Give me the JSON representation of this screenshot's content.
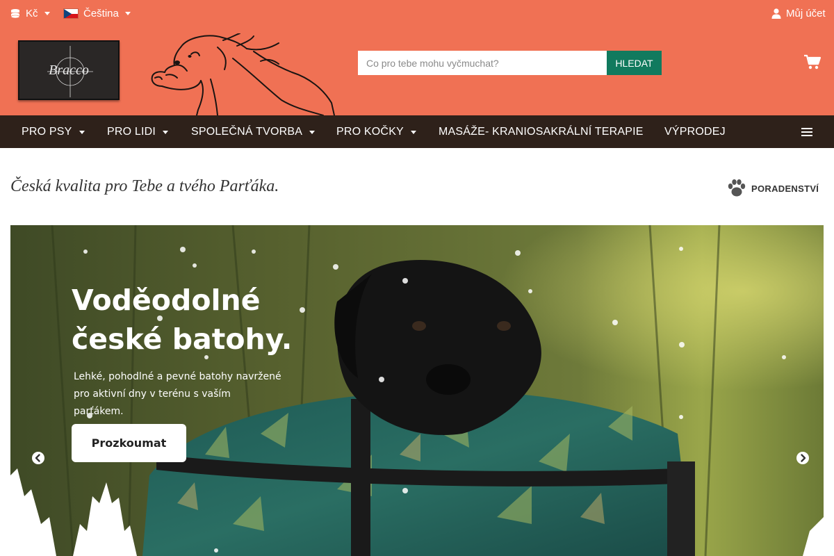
{
  "topbar": {
    "currency": "Kč",
    "language": "Čeština",
    "account": "Můj účet"
  },
  "header": {
    "logo_text": "Bracco",
    "search": {
      "placeholder": "Co pro tebe mohu vyčmuchat?",
      "button": "HLEDAT"
    }
  },
  "nav": {
    "items": [
      {
        "label": "PRO PSY"
      },
      {
        "label": "PRO LIDI"
      },
      {
        "label": "SPOLEČNÁ TVORBA"
      },
      {
        "label": "PRO KOČKY"
      },
      {
        "label": "MASÁŽE- KRANIOSAKRÁLNÍ TERAPIE"
      },
      {
        "label": "VÝPRODEJ"
      }
    ]
  },
  "tagline": "Česká kvalita pro Tebe a tvého Parťáka.",
  "advice": "PORADENSTVÍ",
  "hero": {
    "title_line1": "Voděodolné",
    "title_line2": "české batohy.",
    "subtitle_line1": "Lehké, pohodlné a pevné batohy navržené",
    "subtitle_line2": "pro aktivní dny v terénu s vaším parťákem.",
    "button": "Prozkoumat"
  },
  "colors": {
    "header_bg": "#f07154",
    "nav_bg": "#2e211a",
    "search_button": "#117a5e"
  },
  "icons": {
    "currency": "coins-icon",
    "account": "user-icon",
    "cart": "cart-icon",
    "menu": "hamburger-icon",
    "advice": "paw-icon",
    "prev": "chevron-left-icon",
    "next": "chevron-right-icon"
  }
}
